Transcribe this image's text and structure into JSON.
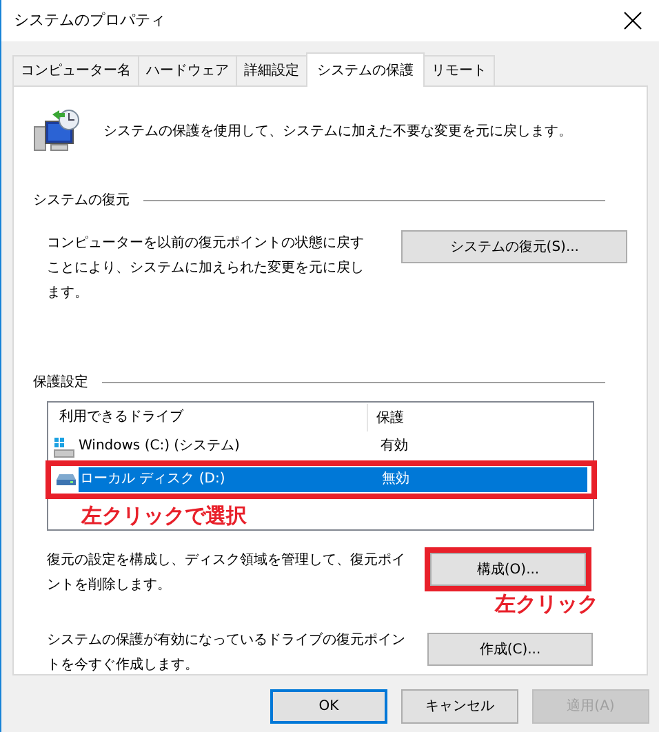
{
  "window": {
    "title": "システムのプロパティ"
  },
  "tabs": [
    {
      "label": "コンピューター名",
      "selected": false
    },
    {
      "label": "ハードウェア",
      "selected": false
    },
    {
      "label": "詳細設定",
      "selected": false
    },
    {
      "label": "システムの保護",
      "selected": true
    },
    {
      "label": "リモート",
      "selected": false
    }
  ],
  "intro": "システムの保護を使用して、システムに加えた不要な変更を元に戻します。",
  "restore": {
    "heading": "システムの復元",
    "description": "コンピューターを以前の復元ポイントの状態に戻すことにより、システムに加えられた変更を元に戻します。",
    "button": "システムの復元(S)..."
  },
  "protection": {
    "heading": "保護設定",
    "columns": [
      "利用できるドライブ",
      "保護"
    ],
    "drives": [
      {
        "name": "Windows (C:) (システム)",
        "protection": "有効",
        "kind": "system",
        "selected": false
      },
      {
        "name": "ローカル ディスク (D:)",
        "protection": "無効",
        "kind": "disk",
        "selected": true
      }
    ],
    "configure": {
      "description": "復元の設定を構成し、ディスク領域を管理して、復元ポイントを削除します。",
      "button": "構成(O)...",
      "highlighted": true
    },
    "create": {
      "description": "システムの保護が有効になっているドライブの復元ポイントを今すぐ作成します。",
      "button": "作成(C)...",
      "highlighted": false
    }
  },
  "annotations": {
    "select_label": "左クリックで選択",
    "click_label": "左クリック"
  },
  "dialog_buttons": [
    {
      "label": "OK",
      "default": true,
      "disabled": false
    },
    {
      "label": "キャンセル",
      "default": false,
      "disabled": false
    },
    {
      "label": "適用(A)",
      "default": false,
      "disabled": true
    }
  ]
}
